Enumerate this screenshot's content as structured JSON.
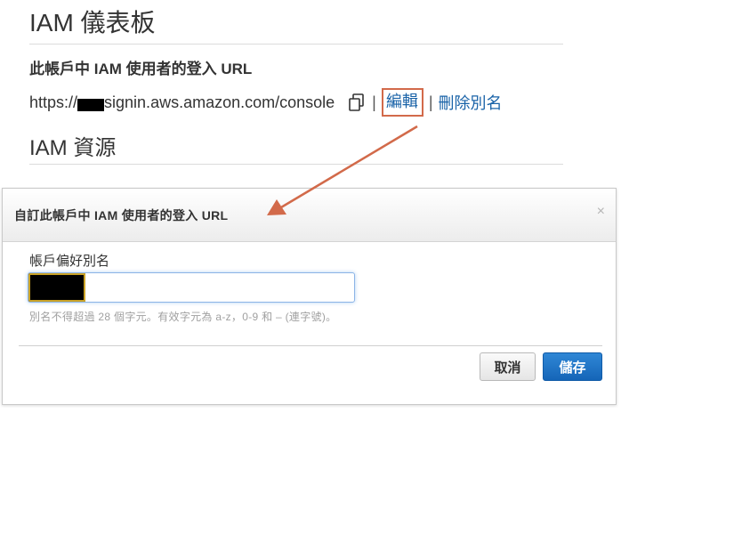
{
  "dashboard": {
    "title": "IAM 儀表板",
    "signin_heading": "此帳戶中 IAM 使用者的登入 URL",
    "url_prefix": "https://",
    "url_suffix": "signin.aws.amazon.com/console",
    "copy_icon": "copy-icon",
    "separator": "|",
    "edit_label": "編輯",
    "delete_alias_label": "刪除別名",
    "resources_title": "IAM 資源"
  },
  "modal": {
    "title": "自訂此帳戶中 IAM 使用者的登入 URL",
    "close_glyph": "×",
    "alias_label": "帳戶偏好別名",
    "alias_value": "",
    "help_text": "別名不得超過 28 個字元。有效字元為 a-z，0-9 和 – (連字號)。",
    "cancel_label": "取消",
    "save_label": "儲存"
  },
  "colors": {
    "link": "#1a63a8",
    "annotation": "#d26a4a",
    "primary_button": "#1b6fc2"
  }
}
